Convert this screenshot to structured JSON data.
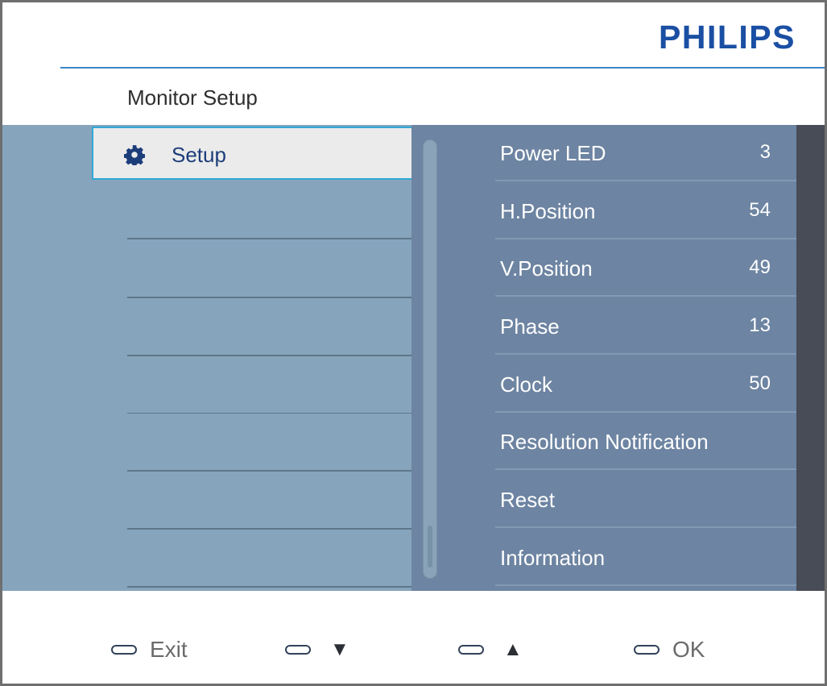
{
  "brand": "PHILIPS",
  "title": "Monitor Setup",
  "menu": {
    "left_items": [
      {
        "label": "Setup",
        "icon": "gear-icon"
      }
    ],
    "right_rows": [
      {
        "label": "Power LED",
        "value": "3"
      },
      {
        "label": "H.Position",
        "value": "54"
      },
      {
        "label": "V.Position",
        "value": "49"
      },
      {
        "label": "Phase",
        "value": "13"
      },
      {
        "label": "Clock",
        "value": "50"
      },
      {
        "label": "Resolution Notification",
        "value": ""
      },
      {
        "label": "Reset",
        "value": ""
      },
      {
        "label": "Information",
        "value": ""
      }
    ]
  },
  "footer": {
    "exit_label": "Exit",
    "down_symbol": "▼",
    "up_symbol": "▲",
    "ok_label": "OK"
  },
  "colors": {
    "brand_blue": "#1a4fa3",
    "osd_blue": "#86a5bd",
    "panel_blue": "#6d84a2",
    "highlight_border": "#2fa9d6"
  }
}
